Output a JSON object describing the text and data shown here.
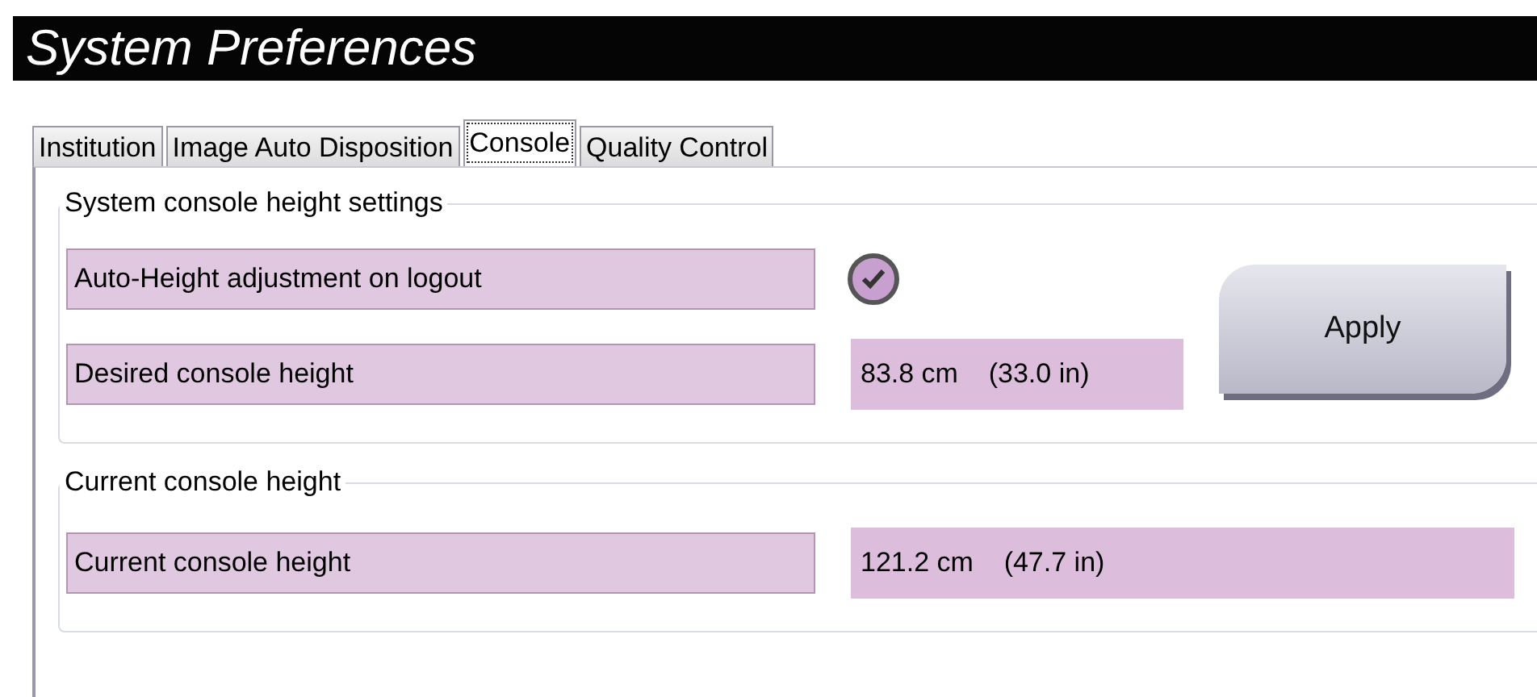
{
  "window": {
    "title": "System Preferences"
  },
  "tabs": [
    {
      "label": "Institution",
      "selected": false
    },
    {
      "label": "Image Auto Disposition",
      "selected": false
    },
    {
      "label": "Console",
      "selected": true
    },
    {
      "label": "Quality Control",
      "selected": false
    }
  ],
  "groups": [
    {
      "legend": "System console height settings",
      "rows": [
        {
          "kind": "checkbox",
          "label": "Auto-Height adjustment on logout",
          "checked": true
        },
        {
          "kind": "value",
          "label": "Desired console height",
          "value": "83.8 cm    (33.0 in)"
        }
      ],
      "button": "Apply"
    },
    {
      "legend": "Current console height",
      "rows": [
        {
          "kind": "wide",
          "label": "Current console height",
          "value": "121.2 cm    (47.7 in)"
        }
      ]
    }
  ]
}
